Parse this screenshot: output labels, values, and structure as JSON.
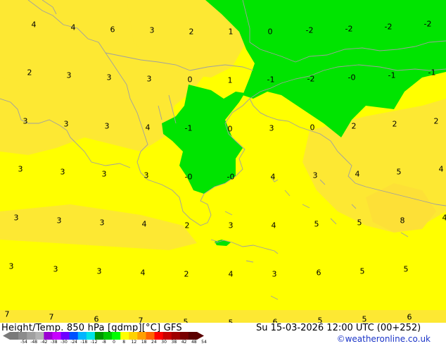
{
  "map": {
    "labels": [
      "4",
      "4",
      "6",
      "3",
      "2",
      "1",
      "0",
      "-2",
      "-2",
      "-2",
      "-2",
      "2",
      "3",
      "3",
      "3",
      "0",
      "1",
      "-1",
      "-2",
      "-0",
      "-1",
      "-1",
      "3",
      "3",
      "3",
      "4",
      "-1",
      "0",
      "3",
      "0",
      "2",
      "2",
      "2",
      "3",
      "3",
      "3",
      "3",
      "-0",
      "-0",
      "4",
      "3",
      "4",
      "5",
      "4",
      "3",
      "3",
      "3",
      "4",
      "2",
      "3",
      "4",
      "5",
      "5",
      "8",
      "4",
      "3",
      "3",
      "3",
      "4",
      "2",
      "4",
      "3",
      "6",
      "5",
      "5",
      "7",
      "7",
      "6",
      "7",
      "5",
      "5",
      "6",
      "5",
      "5",
      "6"
    ],
    "colors": {
      "sea_yellow": "#ffff00",
      "land_yellow": "#fde833",
      "warm_patch": "#fde037",
      "zero_green": "#00e400",
      "coastline": "#a0a0a0"
    }
  },
  "footer": {
    "title": "Height/Temp. 850 hPa [gdmp][°C] GFS",
    "datetime": "Su 15-03-2026 12:00 UTC (00+252)",
    "credit": "©weatheronline.co.uk",
    "scale_ticks": [
      "-54",
      "-48",
      "-42",
      "-38",
      "-30",
      "-24",
      "-18",
      "-12",
      "-8",
      "0",
      "8",
      "12",
      "18",
      "24",
      "30",
      "38",
      "42",
      "48",
      "54"
    ],
    "scale_colors": [
      "#7a7a7a",
      "#8c8c8c",
      "#a0a0a0",
      "#b4b4b4",
      "#9b00d2",
      "#c800ff",
      "#6e00ff",
      "#0050ff",
      "#00b4ff",
      "#00e4e4",
      "#009600",
      "#00c800",
      "#00ff00",
      "#ffff00",
      "#ffd200",
      "#ffa000",
      "#ff6400",
      "#ff0000",
      "#c80000",
      "#a00000",
      "#780000",
      "#5a0000"
    ]
  }
}
